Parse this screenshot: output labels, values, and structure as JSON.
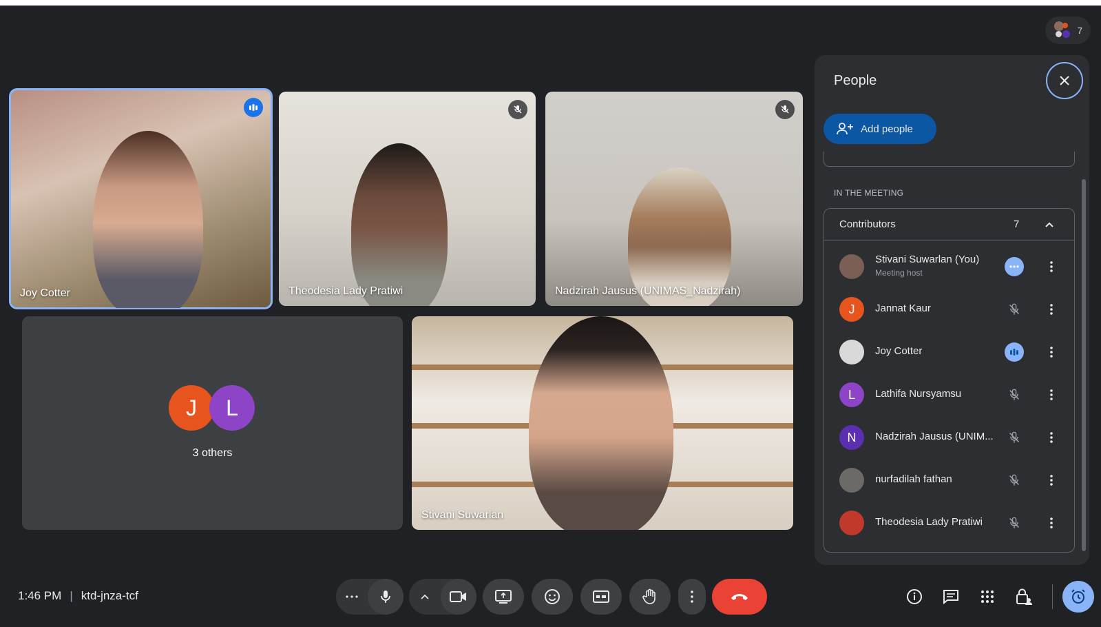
{
  "participant_count": "7",
  "tiles": {
    "joy": {
      "name": "Joy Cotter"
    },
    "theodesia": {
      "name": "Theodesia Lady Pratiwi"
    },
    "nadzirah": {
      "name": "Nadzirah Jausus (UNIMAS_Nadzirah)"
    },
    "others": {
      "avatar1": "J",
      "avatar2": "L",
      "label": "3 others"
    },
    "stivani": {
      "name": "Stivani Suwarlan"
    }
  },
  "panel": {
    "title": "People",
    "add_people": "Add people",
    "section_label": "IN THE MEETING",
    "group_label": "Contributors",
    "group_count": "7",
    "participants": [
      {
        "name": "Stivani Suwarlan (You)",
        "sub": "Meeting host",
        "initial": "",
        "avatar_color": "#7b5f57",
        "status": "more-dots"
      },
      {
        "name": "Jannat Kaur",
        "sub": "",
        "initial": "J",
        "avatar_color": "#e8541e",
        "status": "muted"
      },
      {
        "name": "Joy Cotter",
        "sub": "",
        "initial": "",
        "avatar_color": "#d9d9d9",
        "status": "speaking"
      },
      {
        "name": "Lathifa Nursyamsu",
        "sub": "",
        "initial": "L",
        "avatar_color": "#8e44c7",
        "status": "muted"
      },
      {
        "name": "Nadzirah Jausus (UNIM...",
        "sub": "",
        "initial": "N",
        "avatar_color": "#5b2fb0",
        "status": "muted"
      },
      {
        "name": "nurfadilah fathan",
        "sub": "",
        "initial": "",
        "avatar_color": "#6b6a66",
        "status": "muted"
      },
      {
        "name": "Theodesia Lady Pratiwi",
        "sub": "",
        "initial": "",
        "avatar_color": "#c0392b",
        "status": "muted"
      }
    ]
  },
  "bottom": {
    "time": "1:46 PM",
    "separator": "|",
    "meeting_code": "ktd-jnza-tcf"
  },
  "colors": {
    "accent": "#8ab4f8",
    "end_call": "#ea4335",
    "background": "#202124"
  }
}
